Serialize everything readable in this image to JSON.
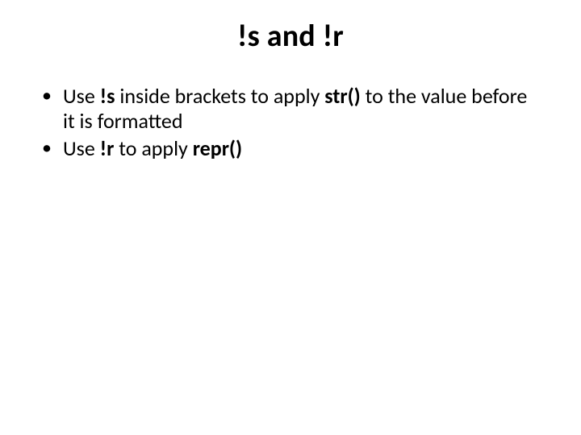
{
  "title": {
    "t1": "!s",
    "t2": " and ",
    "t3": "!r"
  },
  "bullets": [
    {
      "p0": "Use ",
      "p1": "!s",
      "p2": " inside brackets to apply ",
      "p3": "str()",
      "p4": " to the value before it is formatted"
    },
    {
      "p0": "Use ",
      "p1": "!r",
      "p2": " to apply ",
      "p3": "repr()"
    }
  ]
}
